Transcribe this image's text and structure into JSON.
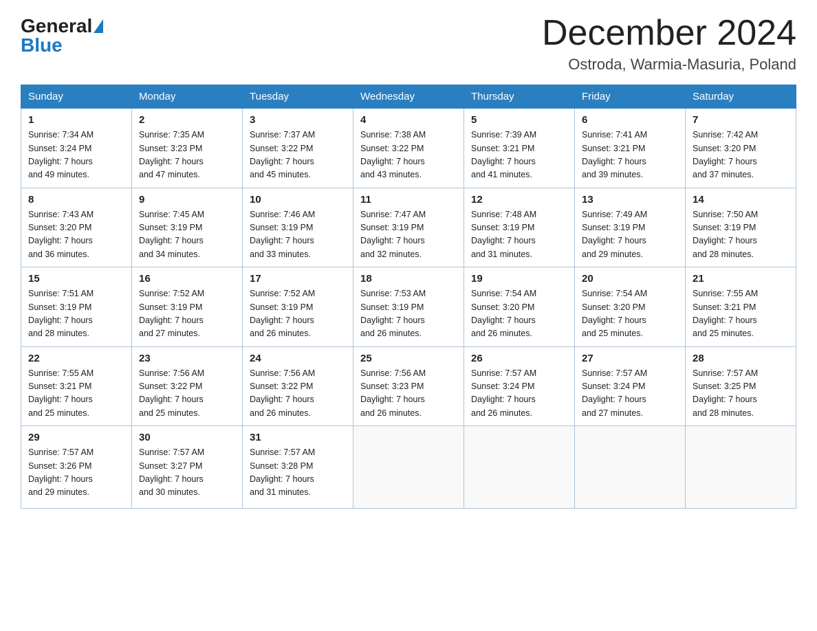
{
  "header": {
    "logo_general": "General",
    "logo_blue": "Blue",
    "month_title": "December 2024",
    "location": "Ostroda, Warmia-Masuria, Poland"
  },
  "days_of_week": [
    "Sunday",
    "Monday",
    "Tuesday",
    "Wednesday",
    "Thursday",
    "Friday",
    "Saturday"
  ],
  "weeks": [
    [
      {
        "day": "1",
        "sunrise": "7:34 AM",
        "sunset": "3:24 PM",
        "daylight": "7 hours and 49 minutes."
      },
      {
        "day": "2",
        "sunrise": "7:35 AM",
        "sunset": "3:23 PM",
        "daylight": "7 hours and 47 minutes."
      },
      {
        "day": "3",
        "sunrise": "7:37 AM",
        "sunset": "3:22 PM",
        "daylight": "7 hours and 45 minutes."
      },
      {
        "day": "4",
        "sunrise": "7:38 AM",
        "sunset": "3:22 PM",
        "daylight": "7 hours and 43 minutes."
      },
      {
        "day": "5",
        "sunrise": "7:39 AM",
        "sunset": "3:21 PM",
        "daylight": "7 hours and 41 minutes."
      },
      {
        "day": "6",
        "sunrise": "7:41 AM",
        "sunset": "3:21 PM",
        "daylight": "7 hours and 39 minutes."
      },
      {
        "day": "7",
        "sunrise": "7:42 AM",
        "sunset": "3:20 PM",
        "daylight": "7 hours and 37 minutes."
      }
    ],
    [
      {
        "day": "8",
        "sunrise": "7:43 AM",
        "sunset": "3:20 PM",
        "daylight": "7 hours and 36 minutes."
      },
      {
        "day": "9",
        "sunrise": "7:45 AM",
        "sunset": "3:19 PM",
        "daylight": "7 hours and 34 minutes."
      },
      {
        "day": "10",
        "sunrise": "7:46 AM",
        "sunset": "3:19 PM",
        "daylight": "7 hours and 33 minutes."
      },
      {
        "day": "11",
        "sunrise": "7:47 AM",
        "sunset": "3:19 PM",
        "daylight": "7 hours and 32 minutes."
      },
      {
        "day": "12",
        "sunrise": "7:48 AM",
        "sunset": "3:19 PM",
        "daylight": "7 hours and 31 minutes."
      },
      {
        "day": "13",
        "sunrise": "7:49 AM",
        "sunset": "3:19 PM",
        "daylight": "7 hours and 29 minutes."
      },
      {
        "day": "14",
        "sunrise": "7:50 AM",
        "sunset": "3:19 PM",
        "daylight": "7 hours and 28 minutes."
      }
    ],
    [
      {
        "day": "15",
        "sunrise": "7:51 AM",
        "sunset": "3:19 PM",
        "daylight": "7 hours and 28 minutes."
      },
      {
        "day": "16",
        "sunrise": "7:52 AM",
        "sunset": "3:19 PM",
        "daylight": "7 hours and 27 minutes."
      },
      {
        "day": "17",
        "sunrise": "7:52 AM",
        "sunset": "3:19 PM",
        "daylight": "7 hours and 26 minutes."
      },
      {
        "day": "18",
        "sunrise": "7:53 AM",
        "sunset": "3:19 PM",
        "daylight": "7 hours and 26 minutes."
      },
      {
        "day": "19",
        "sunrise": "7:54 AM",
        "sunset": "3:20 PM",
        "daylight": "7 hours and 26 minutes."
      },
      {
        "day": "20",
        "sunrise": "7:54 AM",
        "sunset": "3:20 PM",
        "daylight": "7 hours and 25 minutes."
      },
      {
        "day": "21",
        "sunrise": "7:55 AM",
        "sunset": "3:21 PM",
        "daylight": "7 hours and 25 minutes."
      }
    ],
    [
      {
        "day": "22",
        "sunrise": "7:55 AM",
        "sunset": "3:21 PM",
        "daylight": "7 hours and 25 minutes."
      },
      {
        "day": "23",
        "sunrise": "7:56 AM",
        "sunset": "3:22 PM",
        "daylight": "7 hours and 25 minutes."
      },
      {
        "day": "24",
        "sunrise": "7:56 AM",
        "sunset": "3:22 PM",
        "daylight": "7 hours and 26 minutes."
      },
      {
        "day": "25",
        "sunrise": "7:56 AM",
        "sunset": "3:23 PM",
        "daylight": "7 hours and 26 minutes."
      },
      {
        "day": "26",
        "sunrise": "7:57 AM",
        "sunset": "3:24 PM",
        "daylight": "7 hours and 26 minutes."
      },
      {
        "day": "27",
        "sunrise": "7:57 AM",
        "sunset": "3:24 PM",
        "daylight": "7 hours and 27 minutes."
      },
      {
        "day": "28",
        "sunrise": "7:57 AM",
        "sunset": "3:25 PM",
        "daylight": "7 hours and 28 minutes."
      }
    ],
    [
      {
        "day": "29",
        "sunrise": "7:57 AM",
        "sunset": "3:26 PM",
        "daylight": "7 hours and 29 minutes."
      },
      {
        "day": "30",
        "sunrise": "7:57 AM",
        "sunset": "3:27 PM",
        "daylight": "7 hours and 30 minutes."
      },
      {
        "day": "31",
        "sunrise": "7:57 AM",
        "sunset": "3:28 PM",
        "daylight": "7 hours and 31 minutes."
      },
      null,
      null,
      null,
      null
    ]
  ],
  "labels": {
    "sunrise": "Sunrise:",
    "sunset": "Sunset:",
    "daylight": "Daylight:"
  }
}
